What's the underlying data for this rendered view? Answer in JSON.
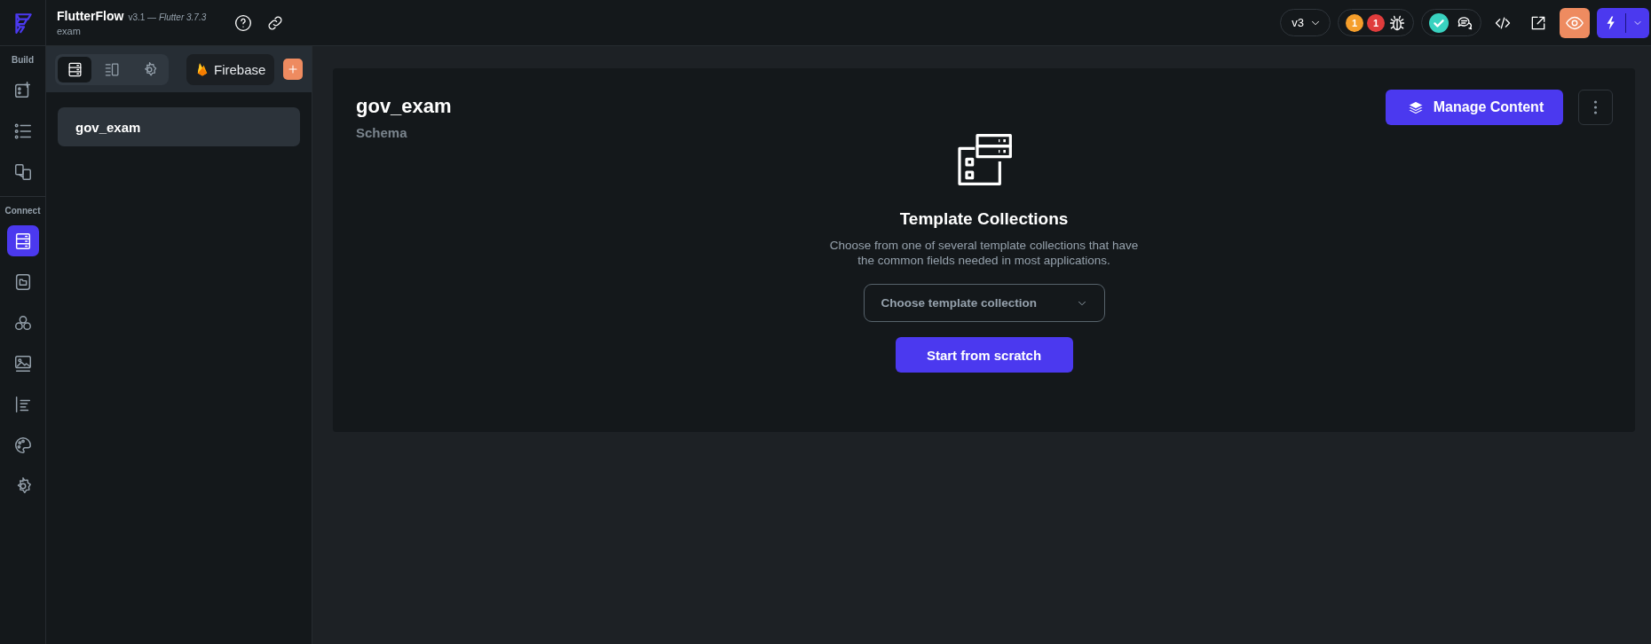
{
  "header": {
    "app_name": "FlutterFlow",
    "version": "v3.1 — ",
    "flutter_version": "Flutter 3.7.3",
    "project": "exam"
  },
  "toolbar": {
    "version_selector": "v3",
    "issues": [
      {
        "count": "1",
        "color": "#f59e2b"
      },
      {
        "count": "1",
        "color": "#e03c3c"
      }
    ],
    "status_ok": true
  },
  "rail": {
    "sections": [
      {
        "label": "Build",
        "items": [
          {
            "kind": "add-widget",
            "selected": false
          },
          {
            "kind": "tree",
            "selected": false
          },
          {
            "kind": "pages",
            "selected": false
          }
        ]
      },
      {
        "label": "Connect",
        "items": [
          {
            "kind": "database",
            "selected": true
          },
          {
            "kind": "storage",
            "selected": false
          },
          {
            "kind": "integrations",
            "selected": false
          },
          {
            "kind": "media",
            "selected": false
          },
          {
            "kind": "outline",
            "selected": false
          },
          {
            "kind": "theme",
            "selected": false
          },
          {
            "kind": "settings",
            "selected": false
          }
        ]
      }
    ]
  },
  "panel": {
    "tabs": [
      {
        "kind": "collections",
        "selected": true
      },
      {
        "kind": "layout",
        "selected": false
      },
      {
        "kind": "settings",
        "selected": false
      }
    ],
    "firebase_button": "Firebase",
    "collections": [
      {
        "name": "gov_exam",
        "selected": true
      }
    ]
  },
  "content": {
    "title": "gov_exam",
    "subtitle": "Schema",
    "manage_button": "Manage Content",
    "empty_state": {
      "heading": "Template Collections",
      "description": "Choose from one of several template collections that have the common fields needed in most applications.",
      "dropdown": {
        "placeholder": "Choose template collection"
      },
      "button": "Start from scratch"
    }
  }
}
